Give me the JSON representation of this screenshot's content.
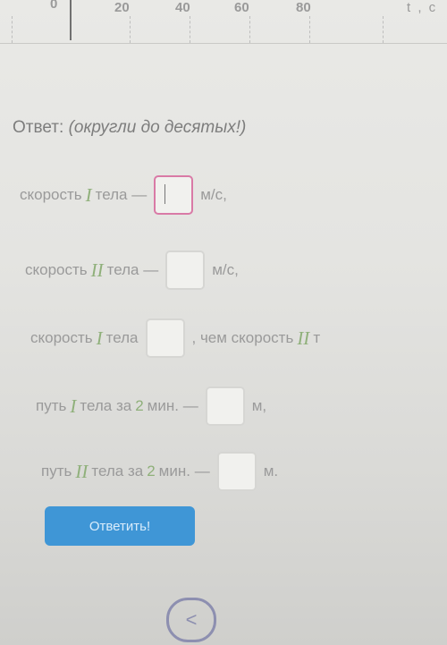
{
  "axis": {
    "ticks": [
      "0",
      "20",
      "40",
      "60",
      "80"
    ],
    "unit": "t , c"
  },
  "answer": {
    "title": "Ответ:",
    "hint": "(округли до десятых!)"
  },
  "rows": [
    {
      "pre": "скорость",
      "roman": "I",
      "post": "тела —",
      "unit": "м/с,"
    },
    {
      "pre": "скорость",
      "roman": "II",
      "post": "тела —",
      "unit": "м/с,"
    },
    {
      "pre": "скорость",
      "roman": "I",
      "post": "тела",
      "after": ", чем скорость",
      "roman2": "II",
      "tail": "т"
    },
    {
      "pre": "путь",
      "roman": "I",
      "mid": "тела за",
      "num": "2",
      "post": "мин. —",
      "unit": "м,"
    },
    {
      "pre": "путь",
      "roman": "II",
      "mid": "тела за",
      "num": "2",
      "post": "мин. —",
      "unit": "м."
    }
  ],
  "submit_label": "Ответить!",
  "back_icon": "<",
  "colors": {
    "accent": "#3f96d6",
    "roman": "#8fb07a",
    "focus": "#d97aa6"
  }
}
